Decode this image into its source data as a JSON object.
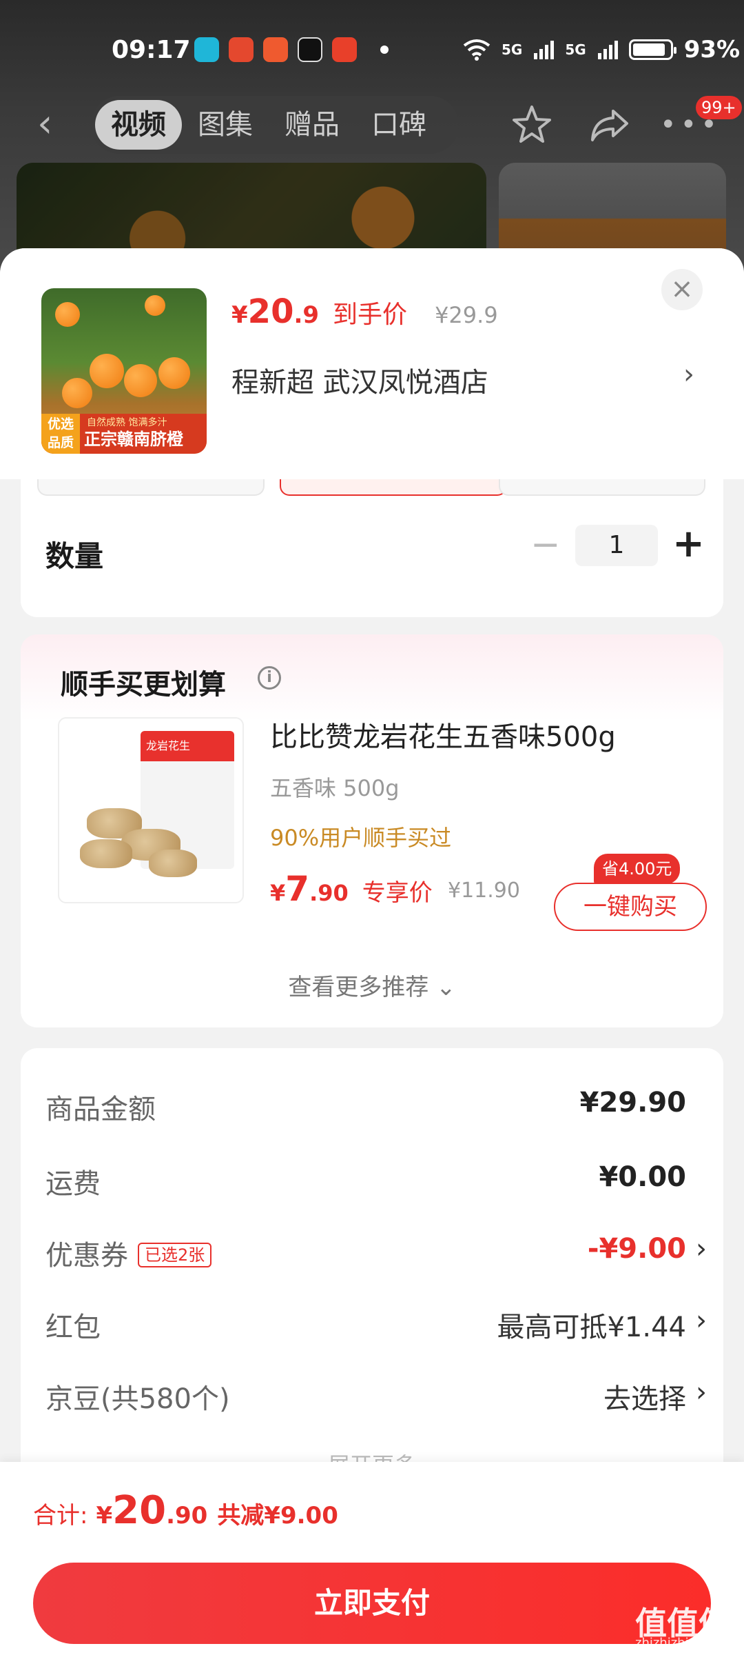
{
  "status_bar": {
    "time": "09:17",
    "signal_1": "5G",
    "signal_2": "5G",
    "battery": "93%"
  },
  "top_nav": {
    "tabs": [
      {
        "label": "视频",
        "active": true
      },
      {
        "label": "图集",
        "active": false
      },
      {
        "label": "赠品",
        "active": false
      },
      {
        "label": "口碑",
        "active": false
      }
    ],
    "cart_badge": "99+"
  },
  "product": {
    "price_yen": "¥",
    "price_int": "20",
    "price_dec": ".9",
    "price_label": "到手价",
    "original_price": "¥29.9",
    "store": "程新超  武汉凤悦酒店",
    "thumb_tag": "优选品质",
    "thumb_slogan": "自然成熟 饱满多汁",
    "thumb_caption": "正宗赣南脐橙"
  },
  "quantity": {
    "label": "数量",
    "value": "1"
  },
  "recommend": {
    "title": "顺手买更划算",
    "item_name": "比比赞龙岩花生五香味500g",
    "item_spec": "五香味   500g",
    "item_bought": "90%用户顺手买过",
    "price_yen": "¥",
    "price_int": "7",
    "price_dec": ".90",
    "price_label": "专享价",
    "original_price": "¥11.90",
    "save_badge": "省4.00元",
    "buy_label": "一键购买",
    "more_label": "查看更多推荐 ⌄",
    "bag_text": "龙岩花生"
  },
  "summary": {
    "rows": [
      {
        "label": "商品金额",
        "value": "¥29.90"
      },
      {
        "label": "运费",
        "value": "¥0.00"
      },
      {
        "label": "优惠券",
        "tag": "已选2张",
        "value": "-¥9.00"
      },
      {
        "label": "红包",
        "value": "最高可抵¥1.44"
      },
      {
        "label": "京豆(共580个)",
        "value": "去选择"
      }
    ],
    "fade_text": "展开更多"
  },
  "bottom": {
    "total_label": "合计:",
    "total_yen": "¥",
    "total_int": "20",
    "total_dec": ".90",
    "discount": "共减¥9.00",
    "pay_label": "立即支付"
  },
  "watermark": {
    "text": "值值值",
    "sub": "zhizhizhi.com"
  },
  "colors": {
    "accent_red": "#e8302c",
    "gold": "#c98a24"
  }
}
